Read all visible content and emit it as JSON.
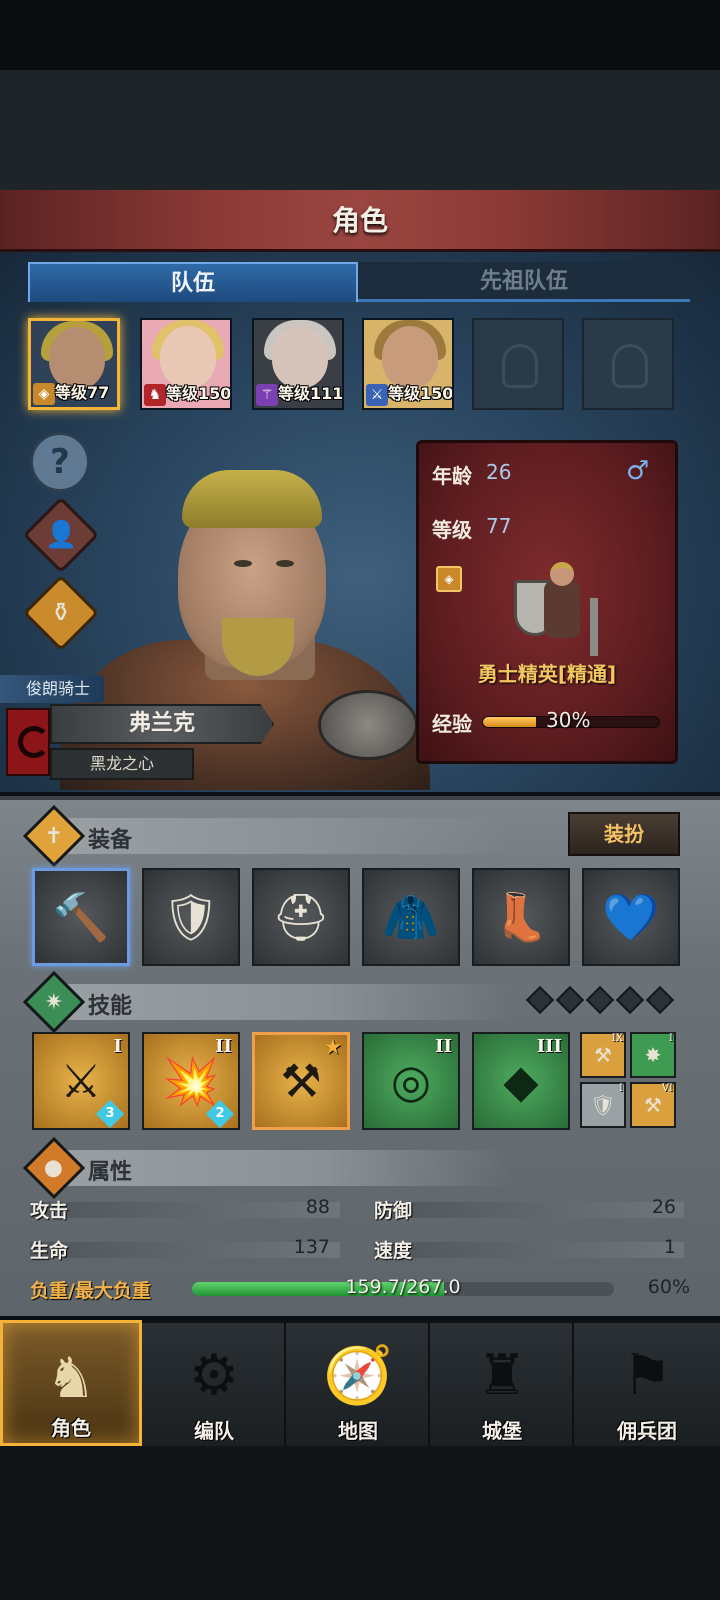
{
  "title": "角色",
  "tabs": {
    "team": "队伍",
    "ancestor_team": "先祖队伍"
  },
  "portraits": [
    {
      "level_label": "等级77",
      "class_icon": "shield-rank-icon",
      "hair": "#b6a03e",
      "skin": "#b58d70",
      "bg": "#2f4258"
    },
    {
      "level_label": "等级150",
      "class_icon": "beast-icon",
      "hair": "#e0c26a",
      "skin": "#e9c7b5",
      "bg": "#e9a9b5"
    },
    {
      "level_label": "等级111",
      "class_icon": "staff-icon",
      "hair": "#c9c5bf",
      "skin": "#d6c4bb",
      "bg": "#3a3f46"
    },
    {
      "level_label": "等级150",
      "class_icon": "sword-icon",
      "hair": "#9c7a3d",
      "skin": "#c79b7c",
      "bg": "#d7b46a"
    }
  ],
  "side_buttons": {
    "help": "?",
    "cloak": "cloak-icon",
    "potion": "potion-icon"
  },
  "hero": {
    "class_tag": "俊朗骑士",
    "name": "弗兰克",
    "subtitle": "黑龙之心"
  },
  "info": {
    "age_label": "年龄",
    "age_value": "26",
    "level_label": "等级",
    "level_value": "77",
    "gender_symbol": "♂",
    "elite_label": "勇士精英[精通]",
    "exp_label": "经验",
    "exp_percent_text": "30%",
    "exp_fraction": 0.3
  },
  "equipment": {
    "title": "装备",
    "outfit_button": "装扮",
    "slots": [
      {
        "name": "hammer-icon",
        "glyph": "🔨"
      },
      {
        "name": "shield-icon",
        "glyph": "🛡"
      },
      {
        "name": "helmet-icon",
        "glyph": "⛑"
      },
      {
        "name": "armor-icon",
        "glyph": "🧥"
      },
      {
        "name": "boots-icon",
        "glyph": "👢"
      },
      {
        "name": "amulet-icon",
        "glyph": "💙"
      }
    ]
  },
  "skills": {
    "title": "技能",
    "pips": 5,
    "slots": [
      {
        "name": "shield-strike-skill-icon",
        "glyph": "⚔",
        "rank": "I",
        "sub": "3",
        "color": "gold"
      },
      {
        "name": "smash-skill-icon",
        "glyph": "💥",
        "rank": "II",
        "sub": "2",
        "color": "gold"
      },
      {
        "name": "shield-bash-skill-icon",
        "glyph": "⚒",
        "rank": "★",
        "sub": "",
        "color": "gold"
      },
      {
        "name": "target-skill-icon",
        "glyph": "◎",
        "rank": "II",
        "sub": "",
        "color": "green"
      },
      {
        "name": "crystal-skill-icon",
        "glyph": "◆",
        "rank": "III",
        "sub": "",
        "color": "green"
      }
    ],
    "mini": [
      {
        "name": "mini-skill-1-icon",
        "glyph": "⚒",
        "rank": "IX",
        "color": "gold"
      },
      {
        "name": "mini-skill-2-icon",
        "glyph": "✸",
        "rank": "I",
        "color": "green"
      },
      {
        "name": "mini-skill-3-icon",
        "glyph": "🛡",
        "rank": "I",
        "color": "grey"
      },
      {
        "name": "mini-skill-4-icon",
        "glyph": "⚒",
        "rank": "VI",
        "color": "gold"
      }
    ]
  },
  "attributes": {
    "title": "属性",
    "attack_label": "攻击",
    "attack_value": "88",
    "defense_label": "防御",
    "defense_value": "26",
    "hp_label": "生命",
    "hp_value": "137",
    "speed_label": "速度",
    "speed_value": "1",
    "load_label": "负重/最大负重",
    "load_value": "159.7/267.0",
    "load_percent_text": "60%",
    "load_fraction": 0.598
  },
  "nav": [
    {
      "label": "角色",
      "glyph": "♞",
      "active": true
    },
    {
      "label": "编队",
      "glyph": "⚙",
      "active": false
    },
    {
      "label": "地图",
      "glyph": "🧭",
      "active": false
    },
    {
      "label": "城堡",
      "glyph": "♜",
      "active": false
    },
    {
      "label": "佣兵团",
      "glyph": "⚑",
      "active": false
    }
  ],
  "colors": {
    "accent_gold": "#f5b239",
    "panel_red": "#7e2b2d",
    "tab_blue": "#2f6aa8"
  }
}
